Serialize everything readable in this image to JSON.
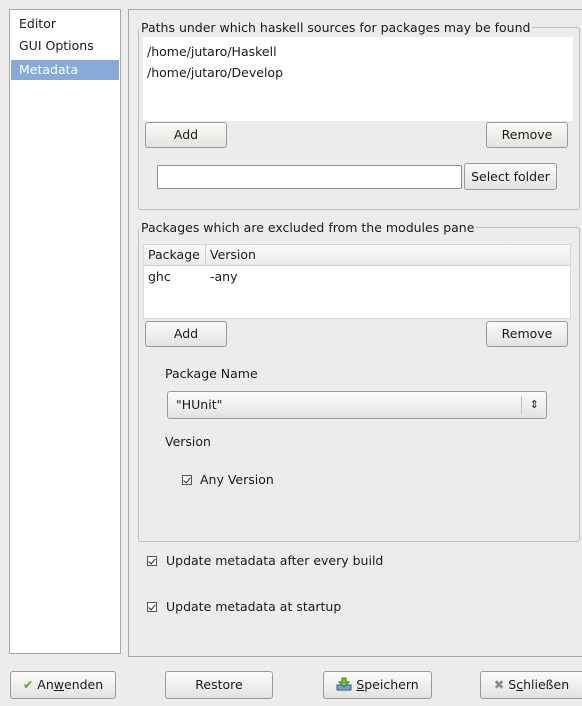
{
  "sidebar": {
    "items": [
      {
        "label": "Editor"
      },
      {
        "label": "GUI Options"
      },
      {
        "label": "Metadata",
        "selected": true
      }
    ]
  },
  "paths_group": {
    "title": "Paths under which haskell sources for packages may be found",
    "paths": [
      "/home/jutaro/Haskell",
      "/home/jutaro/Develop"
    ],
    "add_label": "Add",
    "remove_label": "Remove",
    "folder_value": "",
    "select_folder_label": "Select folder"
  },
  "excluded_group": {
    "title": "Packages which are excluded from the modules pane",
    "columns": [
      "Package",
      "Version"
    ],
    "rows": [
      {
        "package": "ghc",
        "version": "-any"
      }
    ],
    "add_label": "Add",
    "remove_label": "Remove",
    "package_name_label": "Package Name",
    "package_name_value": "\"HUnit\"",
    "version_label": "Version",
    "any_version_label": "Any Version",
    "any_version_checked": true
  },
  "options": {
    "update_after_build_label": "Update metadata after every build",
    "update_after_build_checked": true,
    "update_at_startup_label": "Update metadata at startup",
    "update_at_startup_checked": true
  },
  "footer": {
    "apply_label_pre": "An",
    "apply_label_mn": "w",
    "apply_label_post": "enden",
    "restore_label": "Restore",
    "save_label_mn": "S",
    "save_label_post": "peichern",
    "close_label_pre": "S",
    "close_label_mn": "c",
    "close_label_post": "hließen"
  },
  "colors": {
    "selection": "#86abd9",
    "apply_icon": "#5aa72c",
    "close_icon": "#8a8a8a"
  }
}
